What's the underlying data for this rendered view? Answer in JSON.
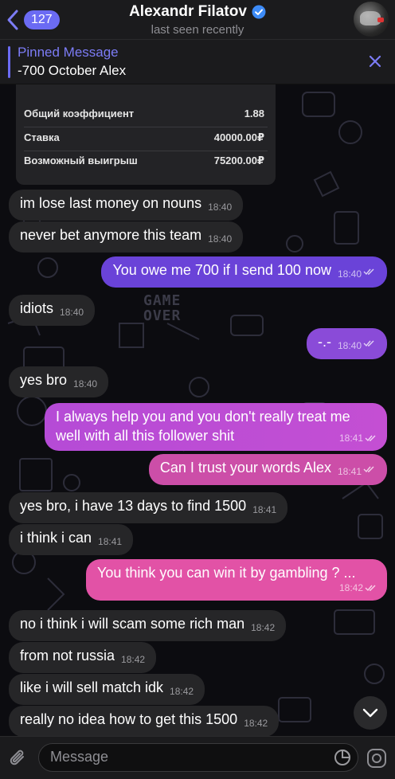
{
  "header": {
    "back_badge": "127",
    "name": "Alexandr Filatov",
    "status": "last seen recently",
    "icons": [
      "chevron-left-icon",
      "verified-icon",
      "avatar"
    ]
  },
  "pinned": {
    "title": "Pinned Message",
    "text": "-700 October Alex"
  },
  "bet_slip": {
    "rows": [
      {
        "label": "Общий коэффициент",
        "value": "1.88"
      },
      {
        "label": "Ставка",
        "value": "40000.00₽"
      },
      {
        "label": "Возможный выигрыш",
        "value": "75200.00₽"
      }
    ]
  },
  "background_text": {
    "game_over_1": "GAME",
    "game_over_2": "OVER"
  },
  "messages": [
    {
      "text": "im lose last money on nouns",
      "time": "18:40",
      "dir": "in"
    },
    {
      "text": "never bet anymore this team",
      "time": "18:40",
      "dir": "in"
    },
    {
      "text": "You owe me 700 if I send 100 now",
      "time": "18:40",
      "dir": "out"
    },
    {
      "text": "idiots",
      "time": "18:40",
      "dir": "in"
    },
    {
      "text": "-.-",
      "time": "18:40",
      "dir": "out"
    },
    {
      "text": "yes bro",
      "time": "18:40",
      "dir": "in"
    },
    {
      "text": "I always help you and you don't really treat me well with all this follower shit",
      "time": "18:41",
      "dir": "out"
    },
    {
      "text": "Can I trust your words Alex",
      "time": "18:41",
      "dir": "out"
    },
    {
      "text": "yes bro, i have 13 days to find 1500",
      "time": "18:41",
      "dir": "in"
    },
    {
      "text": "i think i can",
      "time": "18:41",
      "dir": "in"
    },
    {
      "text": "You think you can win it by gambling ? ...",
      "time": "18:42",
      "dir": "out"
    },
    {
      "text": "no i think i will scam some rich man",
      "time": "18:42",
      "dir": "in"
    },
    {
      "text": "from not russia",
      "time": "18:42",
      "dir": "in"
    },
    {
      "text": "like i will sell match idk",
      "time": "18:42",
      "dir": "in"
    },
    {
      "text": "really no idea how to get this 1500",
      "time": "18:42",
      "dir": "in"
    }
  ],
  "input": {
    "placeholder": "Message"
  },
  "colors": {
    "accent": "#6b6bf3",
    "incoming_bubble": "#262628",
    "header_bg": "#1b1b1d"
  }
}
